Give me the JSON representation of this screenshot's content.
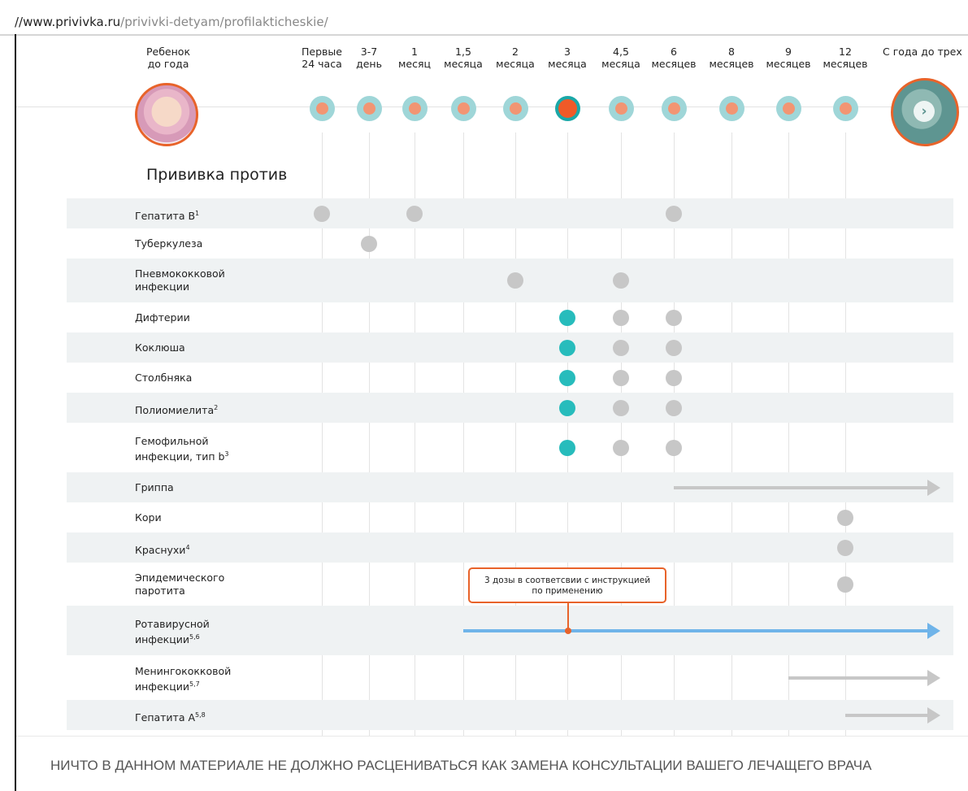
{
  "url": {
    "domain": "//www.privivka.ru",
    "path": "/privivki-detyam/profilakticheskie/"
  },
  "header": {
    "child_label": [
      "Ребенок",
      "до года"
    ],
    "next_label": "С года до трех",
    "columns": [
      {
        "l1": "Первые",
        "l2": "24 часа"
      },
      {
        "l1": "3-7",
        "l2": "день"
      },
      {
        "l1": "1",
        "l2": "месяц"
      },
      {
        "l1": "1,5",
        "l2": "месяца"
      },
      {
        "l1": "2",
        "l2": "месяца"
      },
      {
        "l1": "3",
        "l2": "месяца"
      },
      {
        "l1": "4,5",
        "l2": "месяца"
      },
      {
        "l1": "6",
        "l2": "месяцев"
      },
      {
        "l1": "8",
        "l2": "месяцев"
      },
      {
        "l1": "9",
        "l2": "месяцев"
      },
      {
        "l1": "12",
        "l2": "месяцев"
      }
    ],
    "active_column": 5,
    "next_icon": "chevron-right-icon"
  },
  "section_title": "Прививка против",
  "colors": {
    "accent": "#e8632a",
    "teal": "#27bcbc",
    "grey_dot": "#c7c7c7",
    "blue_line": "#6fb4e9",
    "shade": "#eff2f3"
  },
  "rows": [
    {
      "lines": [
        "Гепатита В"
      ],
      "sup": "1",
      "shade": true,
      "dots": [
        {
          "col": 0,
          "c": "grey"
        },
        {
          "col": 2,
          "c": "grey"
        },
        {
          "col": 7,
          "c": "grey"
        }
      ]
    },
    {
      "lines": [
        "Туберкулеза"
      ],
      "sup": "",
      "shade": false,
      "dots": [
        {
          "col": 1,
          "c": "grey"
        }
      ]
    },
    {
      "lines": [
        "Пневмококковой",
        "инфекции"
      ],
      "sup": "",
      "shade": true,
      "dots": [
        {
          "col": 4,
          "c": "grey"
        },
        {
          "col": 6,
          "c": "grey"
        }
      ]
    },
    {
      "lines": [
        "Дифтерии"
      ],
      "sup": "",
      "shade": false,
      "dots": [
        {
          "col": 5,
          "c": "teal"
        },
        {
          "col": 6,
          "c": "grey"
        },
        {
          "col": 7,
          "c": "grey"
        }
      ]
    },
    {
      "lines": [
        "Коклюша"
      ],
      "sup": "",
      "shade": true,
      "dots": [
        {
          "col": 5,
          "c": "teal"
        },
        {
          "col": 6,
          "c": "grey"
        },
        {
          "col": 7,
          "c": "grey"
        }
      ]
    },
    {
      "lines": [
        "Столбняка"
      ],
      "sup": "",
      "shade": false,
      "dots": [
        {
          "col": 5,
          "c": "teal"
        },
        {
          "col": 6,
          "c": "grey"
        },
        {
          "col": 7,
          "c": "grey"
        }
      ]
    },
    {
      "lines": [
        "Полиомиелита"
      ],
      "sup": "2",
      "shade": true,
      "dots": [
        {
          "col": 5,
          "c": "teal"
        },
        {
          "col": 6,
          "c": "grey"
        },
        {
          "col": 7,
          "c": "grey"
        }
      ]
    },
    {
      "lines": [
        "Гемофильной",
        "инфекции, тип b"
      ],
      "sup": "3",
      "shade": false,
      "dots": [
        {
          "col": 5,
          "c": "teal"
        },
        {
          "col": 6,
          "c": "grey"
        },
        {
          "col": 7,
          "c": "grey"
        }
      ]
    },
    {
      "lines": [
        "Гриппа"
      ],
      "sup": "",
      "shade": true,
      "dots": [],
      "arrow": {
        "from": 7,
        "color": "grey"
      }
    },
    {
      "lines": [
        "Кори"
      ],
      "sup": "",
      "shade": false,
      "dots": [
        {
          "col": 10,
          "c": "grey"
        }
      ]
    },
    {
      "lines": [
        "Краснухи"
      ],
      "sup": "4",
      "shade": true,
      "dots": [
        {
          "col": 10,
          "c": "grey"
        }
      ]
    },
    {
      "lines": [
        "Эпидемического",
        "паротита"
      ],
      "sup": "",
      "shade": false,
      "dots": [
        {
          "col": 10,
          "c": "grey"
        }
      ]
    },
    {
      "lines": [
        "Ротавирусной",
        "инфекции"
      ],
      "sup": "5,6",
      "shade": true,
      "dots": [],
      "arrow": {
        "from": 3,
        "color": "blue"
      }
    },
    {
      "lines": [
        "Менингококковой",
        "инфекции"
      ],
      "sup": "5,7",
      "shade": false,
      "dots": [],
      "arrow": {
        "from": 9,
        "color": "grey"
      }
    },
    {
      "lines": [
        "Гепатита А"
      ],
      "sup": "5,8",
      "shade": true,
      "dots": [],
      "arrow": {
        "from": 10,
        "color": "grey"
      }
    }
  ],
  "tooltip": {
    "line1": "3 дозы в соответсвии с инструкцией",
    "line2": "по применению"
  },
  "footer": "НИЧТО В ДАННОМ МАТЕРИАЛЕ НЕ ДОЛЖНО РАСЦЕНИВАТЬСЯ КАК ЗАМЕНА КОНСУЛЬТАЦИИ ВАШЕГО ЛЕЧАЩЕГО ВРАЧА"
}
